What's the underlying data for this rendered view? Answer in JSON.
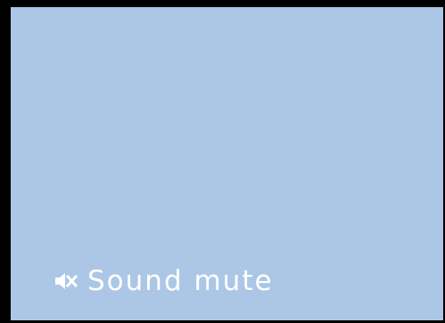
{
  "osd": {
    "status_label": "Sound mute",
    "icon": "speaker-mute-icon",
    "text_color": "#ffffff"
  },
  "screen": {
    "background_color": "#abc7e5",
    "frame_color": "#000000"
  }
}
